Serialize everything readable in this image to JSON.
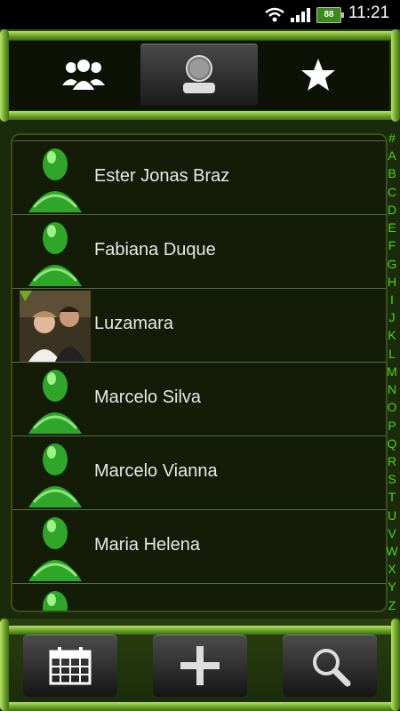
{
  "status_bar": {
    "battery": "88",
    "time": "11:21"
  },
  "tabs": [
    {
      "name": "groups-tab",
      "icon": "groups-icon"
    },
    {
      "name": "people-tab",
      "icon": "person-icon",
      "active": true
    },
    {
      "name": "favorites-tab",
      "icon": "star-icon"
    }
  ],
  "contacts": [
    {
      "name": "Ester Jonas Braz",
      "avatar": "default"
    },
    {
      "name": "Fabiana Duque",
      "avatar": "default"
    },
    {
      "name": "Luzamara",
      "avatar": "photo"
    },
    {
      "name": "Marcelo Silva",
      "avatar": "default"
    },
    {
      "name": "Marcelo Vianna",
      "avatar": "default"
    },
    {
      "name": "Maria Helena",
      "avatar": "default"
    }
  ],
  "index_letters": [
    "#",
    "A",
    "B",
    "C",
    "D",
    "E",
    "F",
    "G",
    "H",
    "I",
    "J",
    "K",
    "L",
    "M",
    "N",
    "O",
    "P",
    "Q",
    "R",
    "S",
    "T",
    "U",
    "V",
    "W",
    "X",
    "Y",
    "Z"
  ],
  "bottom_buttons": [
    {
      "name": "calendar-button",
      "icon": "calendar-grid-icon"
    },
    {
      "name": "add-contact-button",
      "icon": "plus-icon"
    },
    {
      "name": "search-button",
      "icon": "magnifier-icon"
    }
  ],
  "colors": {
    "accent": "#4cd317",
    "background": "#141c08"
  }
}
